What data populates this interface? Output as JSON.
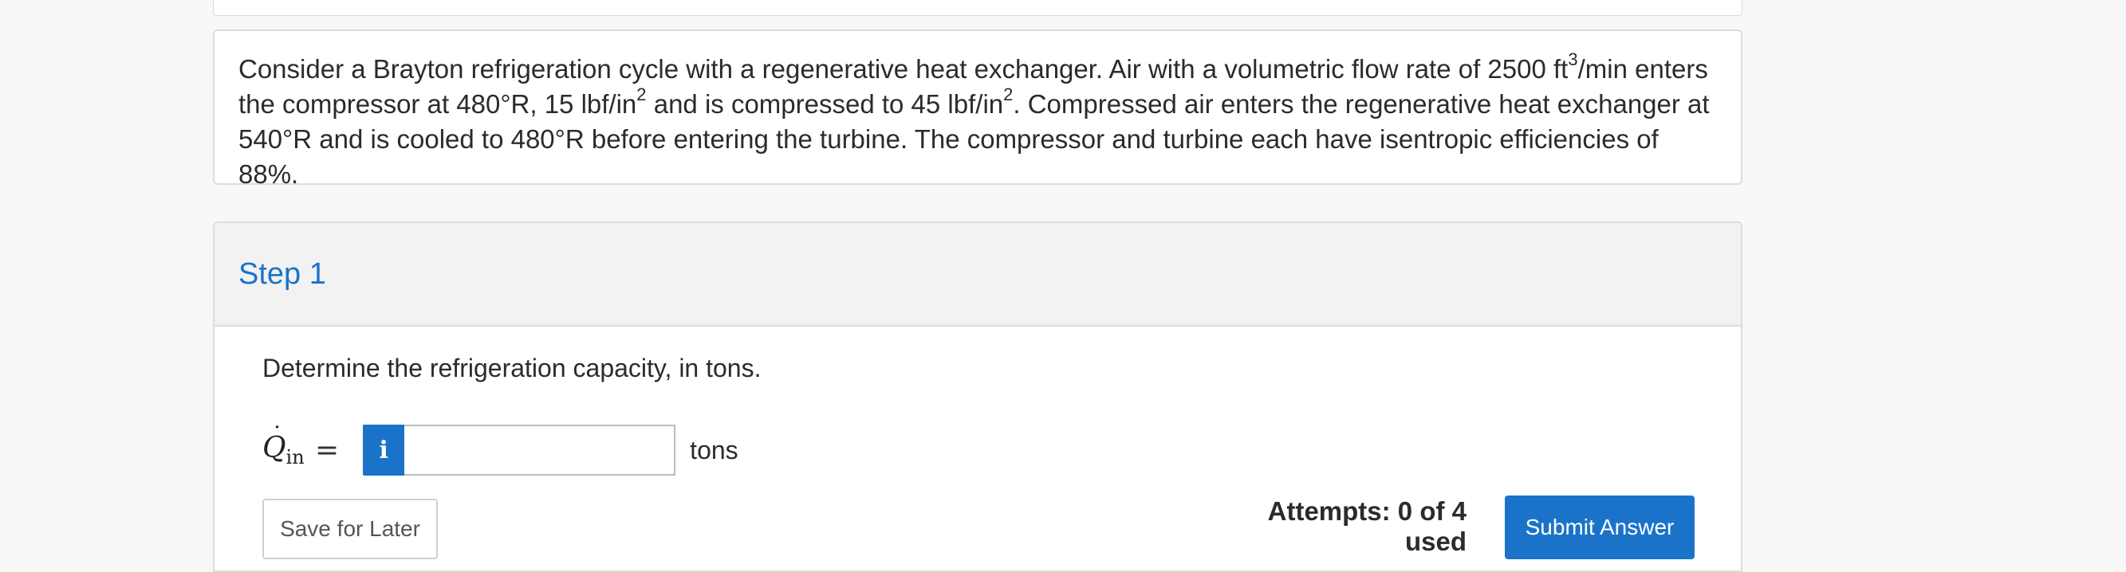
{
  "question": {
    "t1": "Consider a Brayton refrigeration cycle with a regenerative heat exchanger. Air with a volumetric flow rate of 2500 ft",
    "sup1": "3",
    "t2": "/min enters the compressor at 480°R, 15 lbf/in",
    "sup2": "2",
    "t3": " and is compressed to 45 lbf/in",
    "sup3": "2",
    "t4": ". Compressed air enters the regenerative heat exchanger at 540°R and is cooled to 480°R before entering the turbine.  The compressor and turbine each have isentropic efficiencies of 88%."
  },
  "step": {
    "title": "Step 1",
    "prompt": "Determine the refrigeration capacity, in tons.",
    "var_symbol": "Q",
    "var_dot": "˙",
    "var_sub": "in",
    "equals": "=",
    "info_glyph": "i",
    "answer_value": "",
    "unit": "tons",
    "save_label": "Save for Later",
    "attempts_text": "Attempts: 0 of 4 used",
    "submit_label": "Submit Answer"
  },
  "colors": {
    "accent": "#1a73c9",
    "border": "#dcdcdc",
    "header_bg": "#f2f2f2"
  }
}
